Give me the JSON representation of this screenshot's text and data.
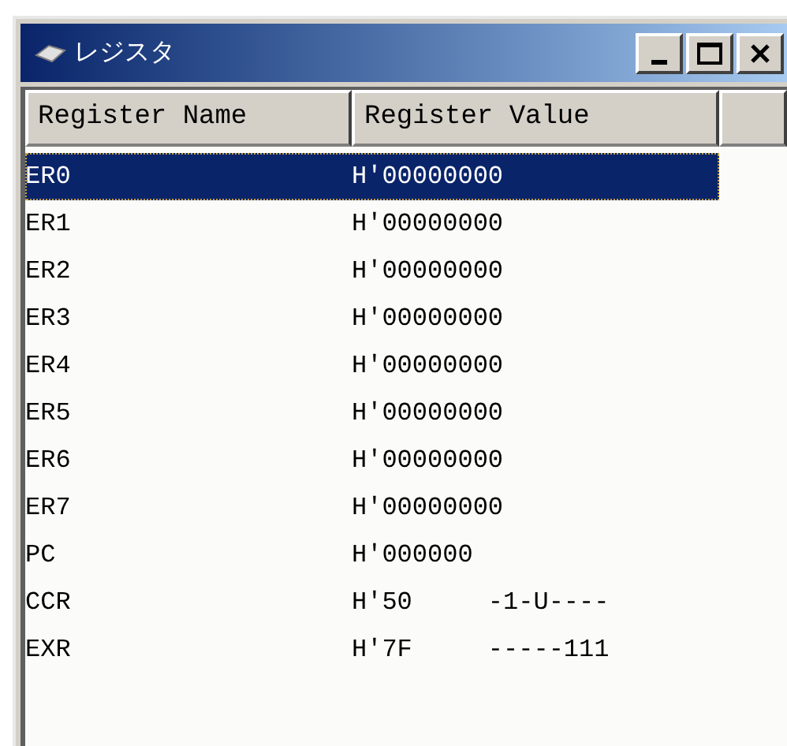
{
  "window": {
    "title": "レジスタ"
  },
  "table": {
    "columns": [
      "Register Name",
      "Register Value"
    ],
    "rows": [
      {
        "name": "ER0",
        "value": "H'00000000",
        "selected": true
      },
      {
        "name": "ER1",
        "value": "H'00000000",
        "selected": false
      },
      {
        "name": "ER2",
        "value": "H'00000000",
        "selected": false
      },
      {
        "name": "ER3",
        "value": "H'00000000",
        "selected": false
      },
      {
        "name": "ER4",
        "value": "H'00000000",
        "selected": false
      },
      {
        "name": "ER5",
        "value": "H'00000000",
        "selected": false
      },
      {
        "name": "ER6",
        "value": "H'00000000",
        "selected": false
      },
      {
        "name": "ER7",
        "value": "H'00000000",
        "selected": false
      },
      {
        "name": "PC",
        "value": "H'000000",
        "selected": false
      },
      {
        "name": "CCR",
        "value": "H'50",
        "flags": "-1-U----",
        "selected": false
      },
      {
        "name": "EXR",
        "value": "H'7F",
        "flags": "-----111",
        "selected": false
      }
    ]
  }
}
